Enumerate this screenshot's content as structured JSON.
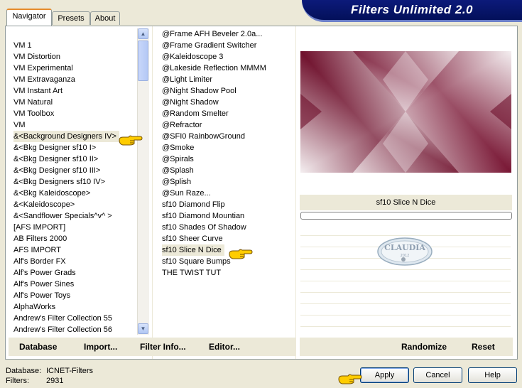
{
  "window": {
    "title": "Filters Unlimited 2.0"
  },
  "tabs": [
    {
      "label": "Navigator",
      "active": true
    },
    {
      "label": "Presets",
      "active": false
    },
    {
      "label": "About",
      "active": false
    }
  ],
  "categories": [
    "VM 1",
    "VM Distortion",
    "VM Experimental",
    "VM Extravaganza",
    "VM Instant Art",
    "VM Natural",
    "VM Toolbox",
    "VM",
    "&<Background Designers IV>",
    "&<Bkg Designer sf10 I>",
    "&<Bkg Designer sf10 II>",
    "&<Bkg Designer sf10 III>",
    "&<Bkg Designers sf10 IV>",
    "&<Bkg Kaleidoscope>",
    "&<Kaleidoscope>",
    "&<Sandflower Specials^v^ >",
    "[AFS IMPORT]",
    "AB Filters 2000",
    "AFS IMPORT",
    "Alf's Border FX",
    "Alf's Power Grads",
    "Alf's Power Sines",
    "Alf's Power Toys",
    "AlphaWorks",
    "Andrew's Filter Collection 55",
    "Andrew's Filter Collection 56"
  ],
  "selected_category_index": 8,
  "filters": [
    "@Frame AFH Beveler 2.0a...",
    "@Frame Gradient Switcher",
    "@Kaleidoscope 3",
    "@Lakeside Reflection MMMM",
    "@Light Limiter",
    "@Night Shadow Pool",
    "@Night Shadow",
    "@Random Smelter",
    "@Refractor",
    "@SFI0 RainbowGround",
    "@Smoke",
    "@Spirals",
    "@Splash",
    "@Splish",
    "@Sun Raze...",
    "sf10 Diamond Flip",
    "sf10 Diamond Mountian",
    "sf10 Shades Of Shadow",
    "sf10 Sheer Curve",
    "sf10 Slice N Dice",
    "sf10 Square Bumps",
    "THE TWIST TUT"
  ],
  "selected_filter_index": 19,
  "left_buttons": {
    "database": "Database",
    "import": "Import...",
    "filter_info": "Filter Info...",
    "editor": "Editor..."
  },
  "right_buttons": {
    "randomize": "Randomize",
    "reset": "Reset"
  },
  "selected_filter_name": "sf10 Slice N Dice",
  "preview": {
    "color_dark": "#6e0f2b",
    "color_light": "#f4eef0"
  },
  "status": {
    "database_label": "Database:",
    "database_value": "ICNET-Filters",
    "filters_label": "Filters:",
    "filters_value": "2931"
  },
  "dialog_buttons": {
    "apply": "Apply",
    "cancel": "Cancel",
    "help": "Help"
  },
  "watermark": {
    "text": "CLAUDIA",
    "year": "2012"
  },
  "colors": {
    "banner": "#0a1670",
    "accent": "#E68B2C",
    "face": "#ECE9D8"
  }
}
